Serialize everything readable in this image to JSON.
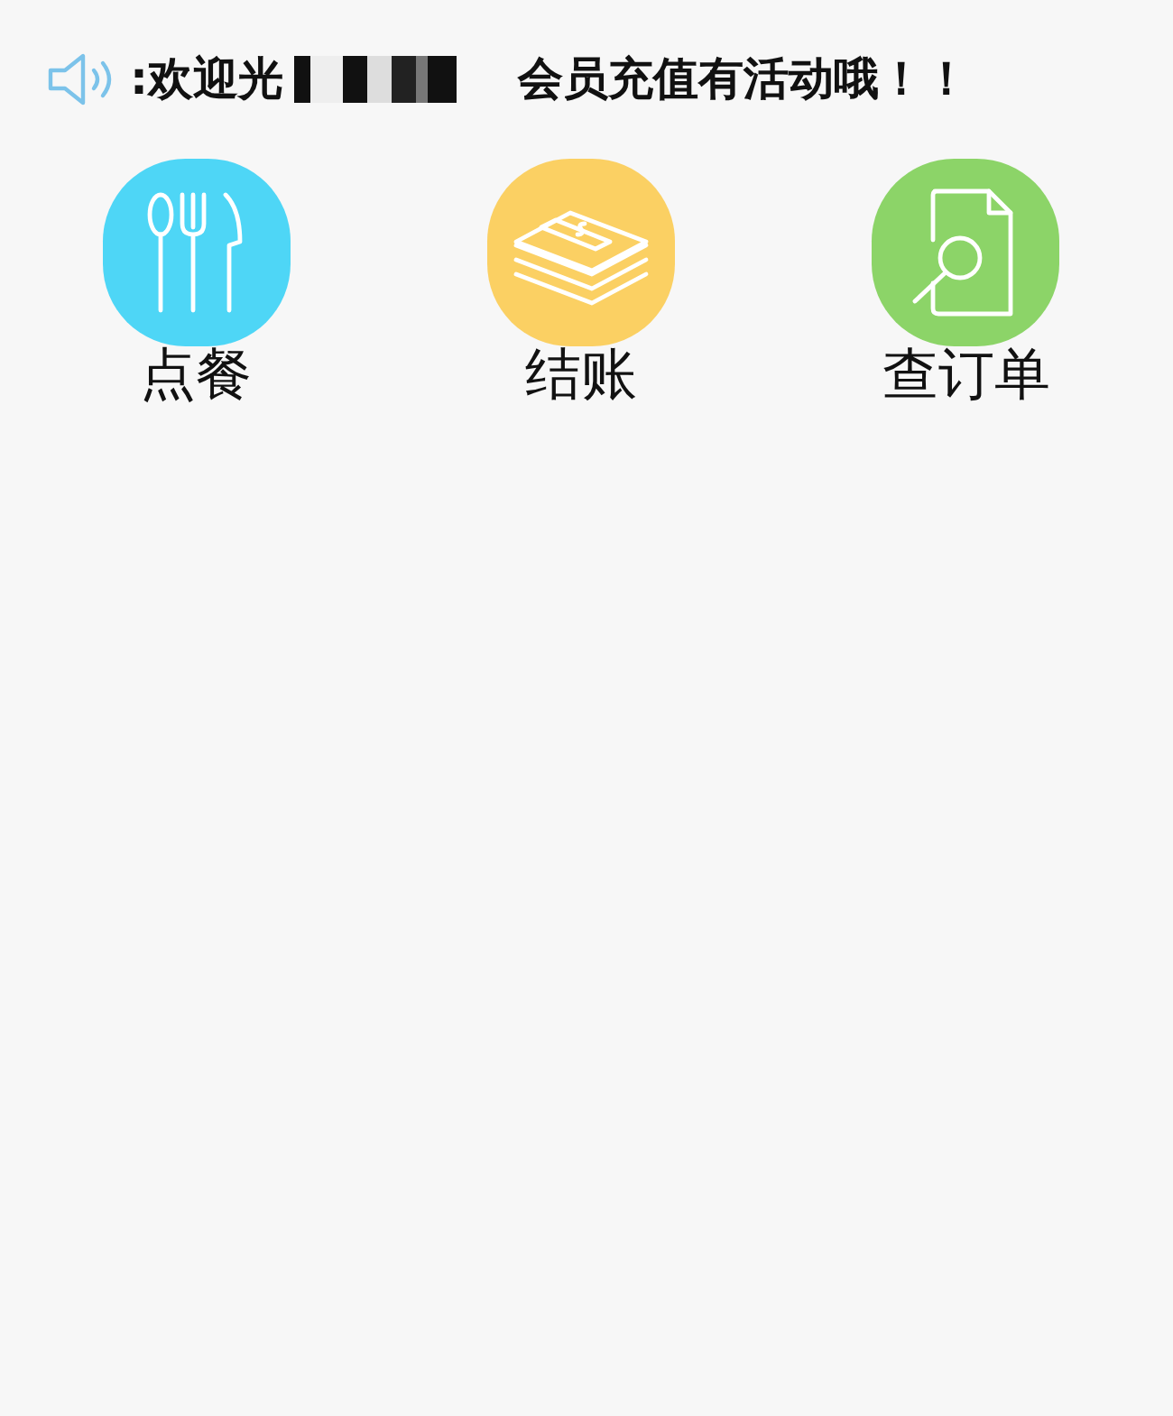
{
  "notice": {
    "before": ":欢迎光",
    "after": "会员充值有活动哦！！"
  },
  "menu": [
    {
      "label": "点餐",
      "kind": "utensils",
      "color": "#4ed6f6"
    },
    {
      "label": "结账",
      "kind": "cash",
      "color": "#fbd063"
    },
    {
      "label": "查订单",
      "kind": "search-doc",
      "color": "#8cd468"
    }
  ]
}
